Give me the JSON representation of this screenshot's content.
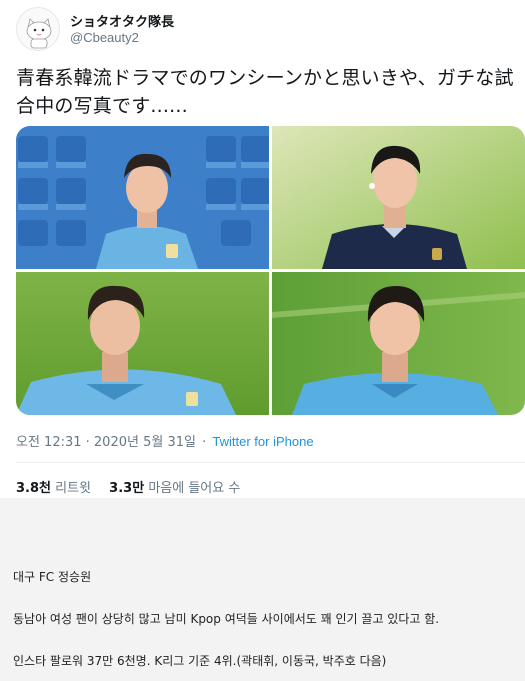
{
  "tweet": {
    "display_name": "ショタオタク隊長",
    "handle": "@Cbeauty2",
    "text": "青春系韓流ドラマでのワンシーンかと思いきや、ガチな試合中の写真です......",
    "timestamp": "오전 12:31 · 2020년 5월 31일",
    "separator": "·",
    "source": "Twitter for iPhone",
    "retweets_count": "3.8천",
    "retweets_label": "리트윗",
    "likes_count": "3.3만",
    "likes_label": "마음에 들어요 수",
    "colors": {
      "link": "#1b95e0",
      "secondary": "#657786",
      "divider": "#e6ecf0"
    }
  },
  "media": {
    "photos": [
      {
        "name": "player-in-stadium-seats"
      },
      {
        "name": "player-in-navy-jacket"
      },
      {
        "name": "player-on-pitch-left"
      },
      {
        "name": "player-on-pitch-right"
      }
    ]
  },
  "post_body": {
    "line1": "대구 FC 정승원",
    "line2": "동남아 여성 팬이 상당히 많고 남미 Kpop 여덕들 사이에서도 꽤 인기 끌고 있다고 함.",
    "line3": "인스타 팔로워 37만 6천명. K리그 기준 4위.(곽태휘, 이동국, 박주호 다음)"
  }
}
